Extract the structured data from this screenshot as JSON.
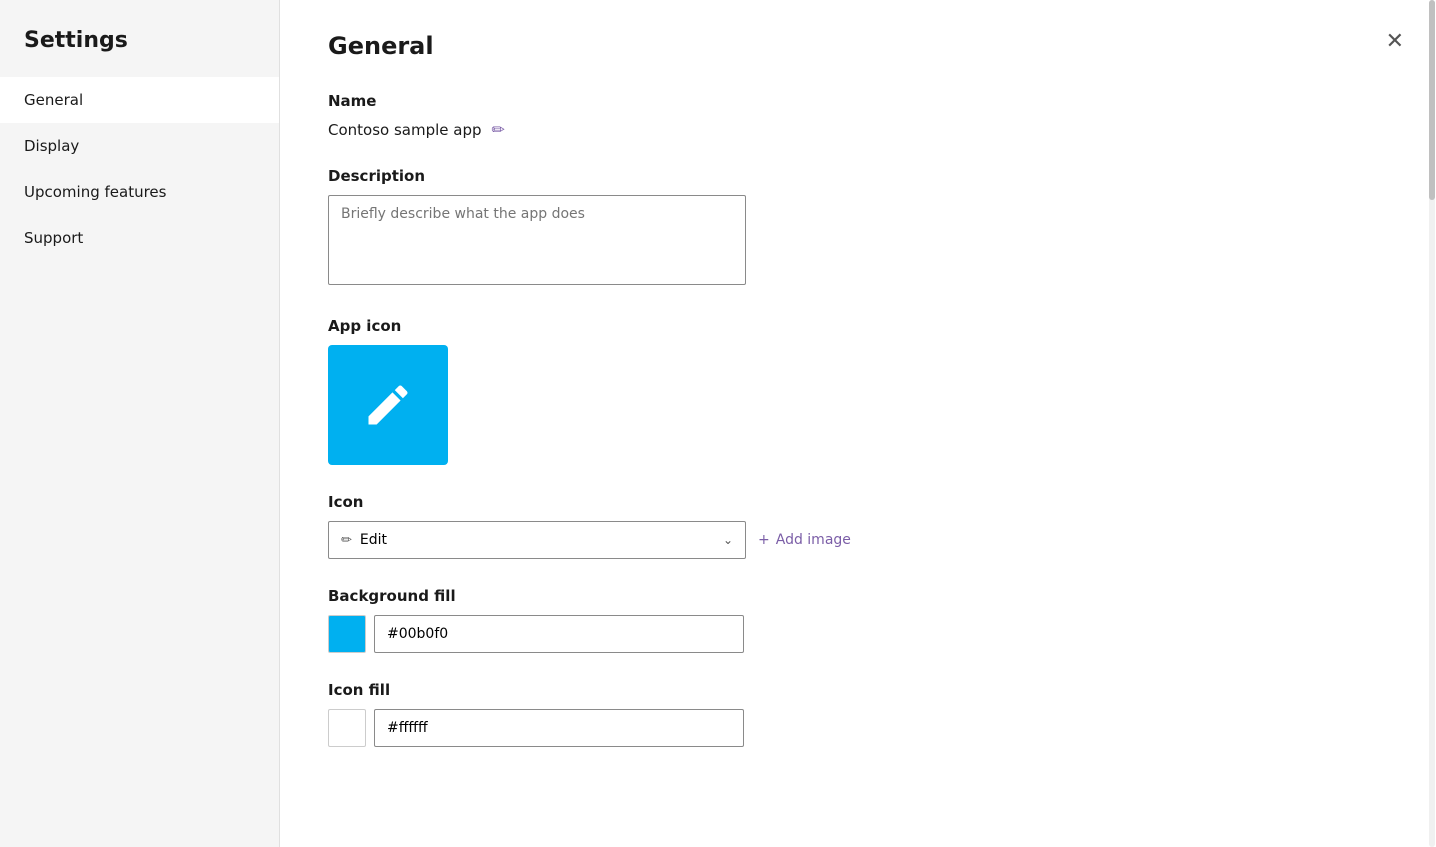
{
  "sidebar": {
    "title": "Settings",
    "items": [
      {
        "id": "general",
        "label": "General",
        "active": true
      },
      {
        "id": "display",
        "label": "Display",
        "active": false
      },
      {
        "id": "upcoming-features",
        "label": "Upcoming features",
        "active": false
      },
      {
        "id": "support",
        "label": "Support",
        "active": false
      }
    ]
  },
  "main": {
    "title": "General",
    "close_label": "✕",
    "sections": {
      "name": {
        "label": "Name",
        "value": "Contoso sample app",
        "edit_tooltip": "Edit"
      },
      "description": {
        "label": "Description",
        "placeholder": "Briefly describe what the app does"
      },
      "app_icon": {
        "label": "App icon",
        "bg_color": "#00b0f0"
      },
      "icon": {
        "label": "Icon",
        "selected_value": "Edit",
        "add_image_label": "+ Add image"
      },
      "background_fill": {
        "label": "Background fill",
        "color": "#00b0f0",
        "value": "#00b0f0"
      },
      "icon_fill": {
        "label": "Icon fill",
        "color": "#ffffff",
        "value": "#ffffff"
      }
    }
  }
}
